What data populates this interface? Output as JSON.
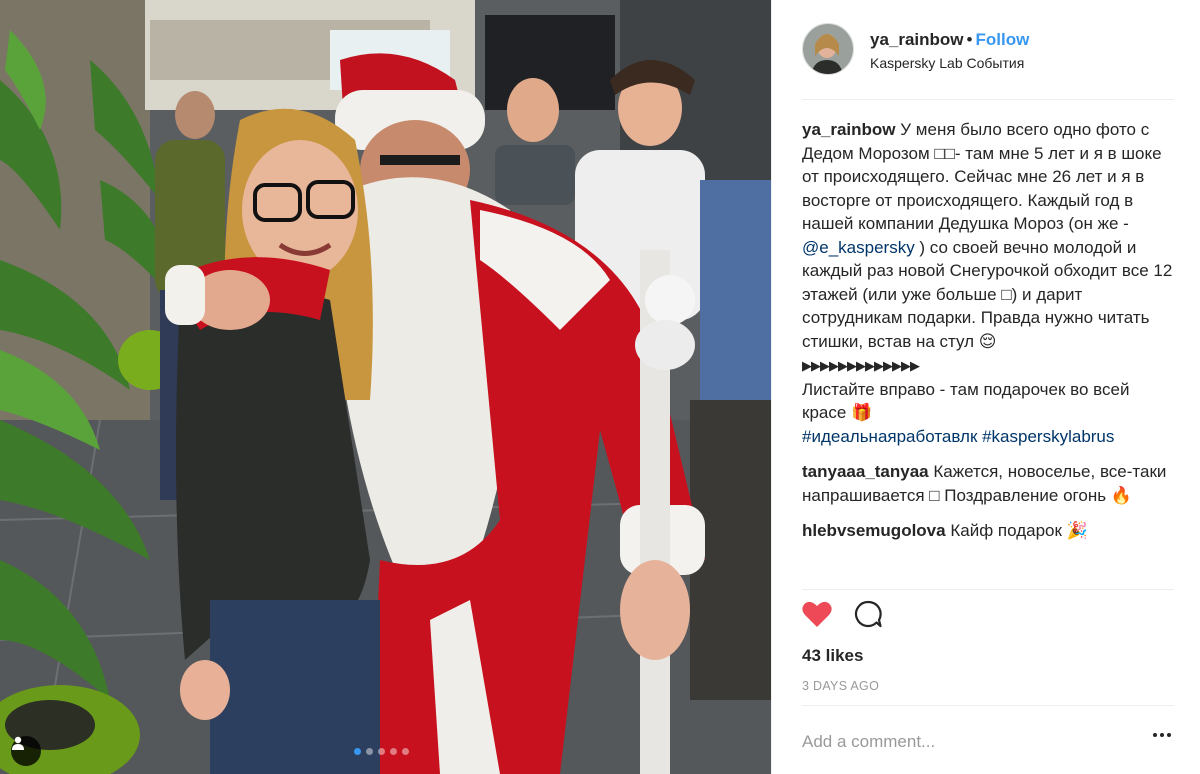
{
  "post": {
    "username": "ya_rainbow",
    "separator": "•",
    "follow_label": "Follow",
    "location": "Kaspersky Lab События",
    "carousel_total": 5,
    "carousel_active": 1
  },
  "caption": {
    "author": "ya_rainbow",
    "text_part1": "У меня было всего одно фото с Дедом Морозом □□- там мне 5 лет и я в шоке от происходящего. Сейчас мне 26 лет и я в восторге от происходящего. Каждый год в нашей компании Дедушка Мороз (он же - ",
    "mention": "@e_kaspersky",
    "text_part2": " ) со своей вечно молодой и каждый раз новой Снегурочкой обходит все 12 этажей (или уже больше □) и дарит сотрудникам подарки. Правда нужно читать стишки, встав на стул 😌",
    "arrows": "▶▶▶▶▶▶▶▶▶▶▶▶▶",
    "text_part3": "Листайте вправо - там подарочек во всей красе 🎁",
    "hashtags": "#идеальнаяработавлк #kasperskylabrus"
  },
  "comments": [
    {
      "author": "tanyaaa_tanyaa",
      "text": "Кажется, новоселье, все-таки напрашивается □ Поздравление огонь 🔥"
    },
    {
      "author": "hlebvsemugolova",
      "text": "Кайф подарок 🎉"
    }
  ],
  "likes": "43 likes",
  "timestamp": "3 DAYS AGO",
  "add_comment_placeholder": "Add a comment...",
  "icons": {
    "like": "heart-icon",
    "comment": "speech-bubble-icon",
    "more": "more-options-icon",
    "user_tag": "person-icon"
  },
  "colors": {
    "like_red": "#ed4956",
    "follow_blue": "#3897f0",
    "link_navy": "#003569"
  }
}
